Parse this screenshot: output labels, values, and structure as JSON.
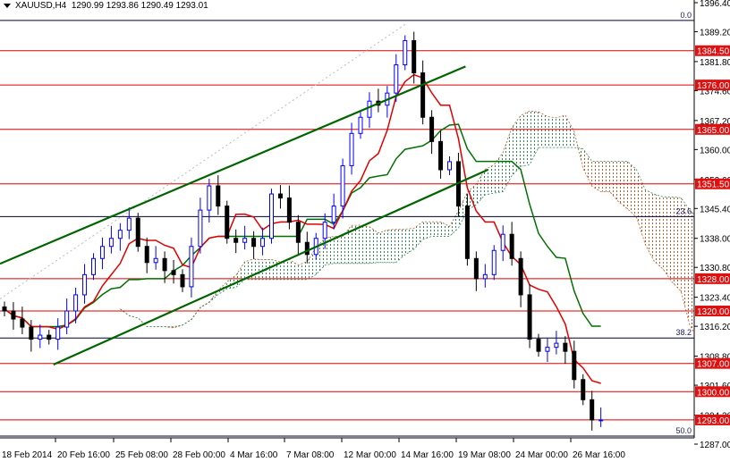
{
  "header": {
    "symbol": "XAUUSD,H4",
    "ohlc": "1290.99 1293.86 1290.49 1293.01"
  },
  "colors": {
    "bull": "#0000ff",
    "bear": "#000000",
    "tenkan": "#e00000",
    "kijun": "#007000",
    "channel": "#006400",
    "level": "#dd0000",
    "fib": "#000030",
    "cloud_up": "#2e8b57",
    "cloud_down": "#c0562a"
  },
  "chart_data": {
    "type": "candlestick",
    "title": "XAUUSD,H4",
    "ylim": [
      1287.0,
      1396.4
    ],
    "y_ticks": [
      "1396.40",
      "1389.20",
      "1381.80",
      "1374.60",
      "1367.20",
      "1360.00",
      "1352.60",
      "1345.40",
      "1338.00",
      "1330.80",
      "1323.40",
      "1316.20",
      "1308.80",
      "1301.60",
      "1294.20",
      "1287.00"
    ],
    "x_ticks": [
      "18 Feb 2014",
      "20 Feb 16:00",
      "25 Feb 08:00",
      "28 Feb 00:00",
      "4 Mar 16:00",
      "7 Mar 08:00",
      "12 Mar 00:00",
      "14 Mar 16:00",
      "19 Mar 08:00",
      "24 Mar 00:00",
      "26 Mar 16:00"
    ],
    "close": [
      1320,
      1318,
      1316,
      1313,
      1314,
      1313,
      1316,
      1320,
      1324,
      1329,
      1333,
      1336,
      1338,
      1340,
      1343,
      1336,
      1332,
      1333,
      1330,
      1329,
      1326,
      1336,
      1345,
      1351,
      1346,
      1338,
      1337,
      1338,
      1336,
      1338,
      1349,
      1348,
      1342,
      1337,
      1334,
      1338,
      1342,
      1346,
      1356,
      1364,
      1368,
      1372,
      1371,
      1374,
      1381,
      1387,
      1379,
      1368,
      1362,
      1355,
      1357,
      1346,
      1333,
      1328,
      1329,
      1335,
      1339,
      1333,
      1324,
      1313,
      1310,
      1311,
      1312,
      1310,
      1303,
      1298,
      1293,
      1293.01
    ],
    "wick": 2.2,
    "ichimoku": {
      "tenkan": 5,
      "kijun": 13,
      "senkou_b": 26,
      "shift": 13
    },
    "price_levels": [
      {
        "price": 1384.5,
        "label": "1384.50"
      },
      {
        "price": 1376.0,
        "label": "1376.00"
      },
      {
        "price": 1365.0,
        "label": "1365.00"
      },
      {
        "price": 1351.5,
        "label": "1351.50"
      },
      {
        "price": 1328.0,
        "label": "1328.00"
      },
      {
        "price": 1320.0,
        "label": "1320.00"
      },
      {
        "price": 1307.0,
        "label": "1307.00"
      },
      {
        "price": 1300.0,
        "label": "1300.00"
      },
      {
        "price": 1293.0,
        "label": "1293.00"
      }
    ],
    "fibonacci": [
      {
        "price": 1392.0,
        "label": "0.0"
      },
      {
        "price": 1343.4,
        "label": "23.6"
      },
      {
        "price": 1313.3,
        "label": "38.2"
      },
      {
        "price": 1289.0,
        "label": "50.0"
      }
    ],
    "channel": [
      {
        "name": "upper",
        "from": {
          "bar": -0.5,
          "price": 1331.7
        },
        "to": {
          "bar": 51.8,
          "price": 1380.6
        }
      },
      {
        "name": "lower",
        "from": {
          "bar": 5.5,
          "price": 1306.7
        },
        "to": {
          "bar": 54.3,
          "price": 1355.0
        }
      }
    ],
    "dotted_trend": {
      "from": {
        "bar": -0.5,
        "price": 1323.0
      },
      "to": {
        "bar": 45,
        "price": 1391.0
      }
    }
  }
}
